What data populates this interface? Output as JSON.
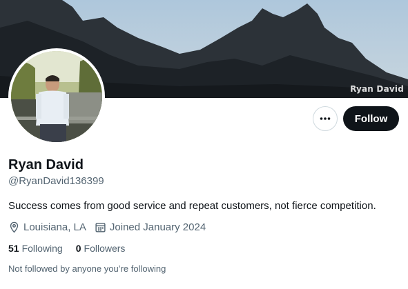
{
  "banner": {
    "watermark": "Ryan David"
  },
  "profile": {
    "name": "Ryan David",
    "handle": "@RyanDavid136399",
    "bio": "Success comes from good service and repeat customers, not fierce competition.",
    "location": "Louisiana, LA",
    "joined": "Joined January 2024",
    "following_count": "51",
    "following_label": "Following",
    "followers_count": "0",
    "followers_label": "Followers",
    "not_followed_text": "Not followed by anyone you’re following"
  },
  "actions": {
    "more_icon": "more-horizontal-icon",
    "follow_label": "Follow"
  },
  "colors": {
    "primary_text": "#0f1419",
    "secondary_text": "#536471",
    "follow_bg": "#0f1419",
    "border": "#cfd9de"
  }
}
